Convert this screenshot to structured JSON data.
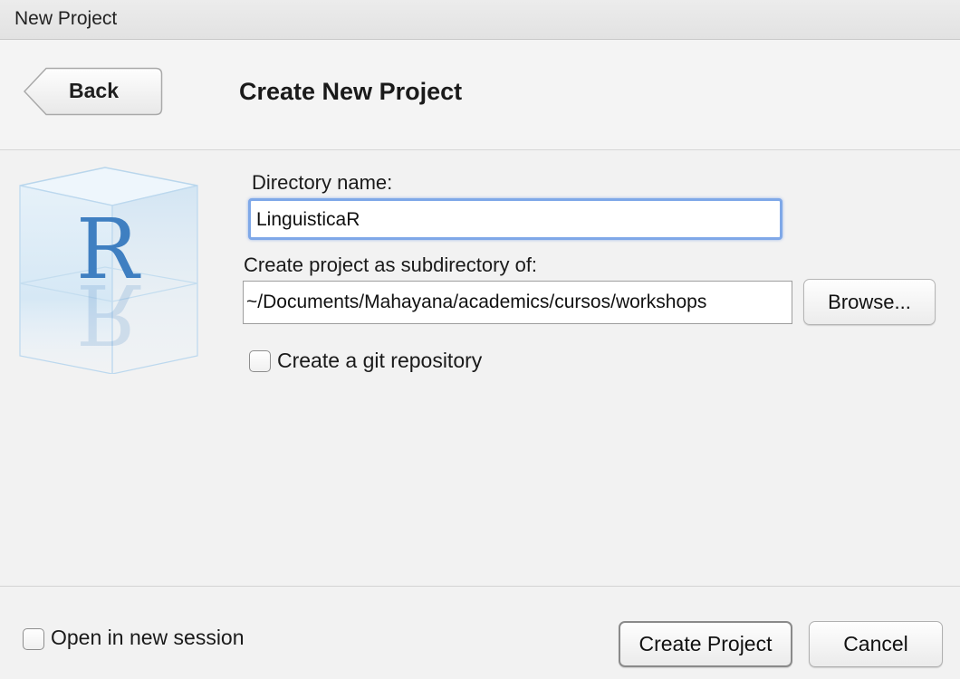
{
  "window": {
    "title": "New Project"
  },
  "header": {
    "back_label": "Back",
    "title": "Create New Project"
  },
  "logo": {
    "letter": "R",
    "icon": "r-cube-logo-icon",
    "accent": "#3f7fc1"
  },
  "form": {
    "directory_label": "Directory name:",
    "directory_value": "LinguisticaR",
    "subdirectory_label": "Create project as subdirectory of:",
    "subdirectory_value": "~/Documents/Mahayana/academics/cursos/workshops",
    "browse_label": "Browse...",
    "git_label": "Create a git repository",
    "git_checked": false
  },
  "footer": {
    "new_session_label": "Open in new session",
    "new_session_checked": false,
    "create_label": "Create Project",
    "cancel_label": "Cancel"
  },
  "colors": {
    "focus_ring": "#7fa8e8",
    "background": "#f3f3f3"
  }
}
